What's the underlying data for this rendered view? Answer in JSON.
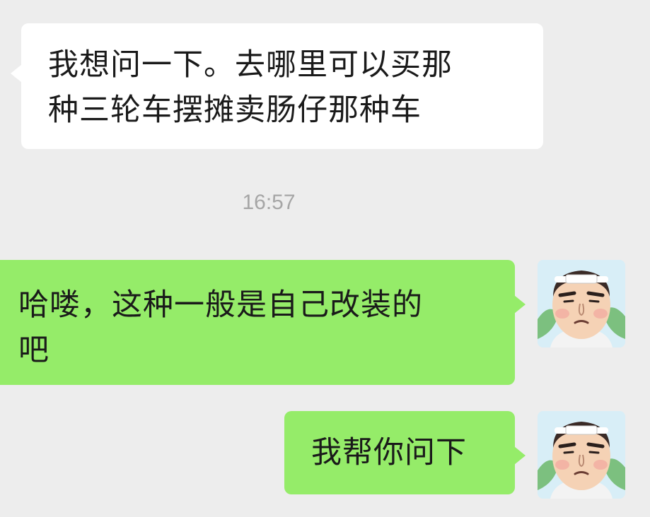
{
  "messages": [
    {
      "side": "left",
      "line1": "我想问一下。去哪里可以买那",
      "line2": "种三轮车摆摊卖肠仔那种车"
    },
    {
      "side": "right",
      "line1": "哈喽，这种一般是自己改装的",
      "line2": "吧"
    },
    {
      "side": "right",
      "line1": "我帮你问下"
    }
  ],
  "timestamp": "16:57",
  "colors": {
    "background": "#ededed",
    "incoming_bubble": "#ffffff",
    "outgoing_bubble": "#95ec69",
    "timestamp_text": "#a6a6a6"
  },
  "icons": {
    "avatar": "cartoon-face-avatar-icon"
  }
}
